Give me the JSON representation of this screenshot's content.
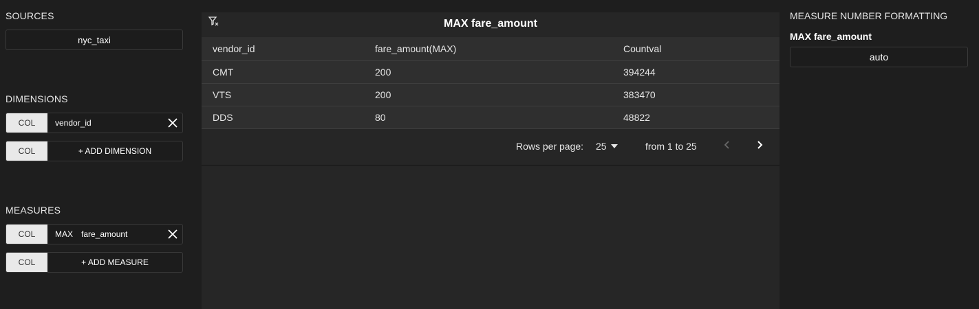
{
  "left": {
    "sources": {
      "title": "SOURCES",
      "value": "nyc_taxi"
    },
    "dimensions": {
      "title": "DIMENSIONS",
      "items": [
        {
          "col_label": "COL",
          "label": "vendor_id"
        }
      ],
      "add": {
        "col_label": "COL",
        "label": "+ ADD DIMENSION"
      }
    },
    "measures": {
      "title": "MEASURES",
      "items": [
        {
          "col_label": "COL",
          "agg": "MAX",
          "label": "fare_amount"
        }
      ],
      "add": {
        "col_label": "COL",
        "label": "+ ADD MEASURE"
      }
    }
  },
  "main": {
    "title": "MAX fare_amount",
    "table": {
      "headers": [
        "vendor_id",
        "fare_amount(MAX)",
        "Countval"
      ],
      "rows": [
        [
          "CMT",
          "200",
          "394244"
        ],
        [
          "VTS",
          "200",
          "383470"
        ],
        [
          "DDS",
          "80",
          "48822"
        ]
      ]
    },
    "pagination": {
      "rows_per_page_label": "Rows per page:",
      "rows_per_page_value": "25",
      "range": "from 1 to 25"
    },
    "icons": {
      "filter": "filter-clear-icon",
      "prev": "chevron-left-icon",
      "next": "chevron-right-icon",
      "dropdown": "caret-down-icon",
      "remove": "close-icon"
    }
  },
  "right": {
    "title": "MEASURE NUMBER FORMATTING",
    "measure_label": "MAX fare_amount",
    "format_value": "auto"
  },
  "colors": {
    "background": "#1e1e1e",
    "panel": "#262626",
    "table_bg": "#2f2f2f",
    "col_button": "#e9e9e9",
    "text": "#e6e6e6"
  }
}
